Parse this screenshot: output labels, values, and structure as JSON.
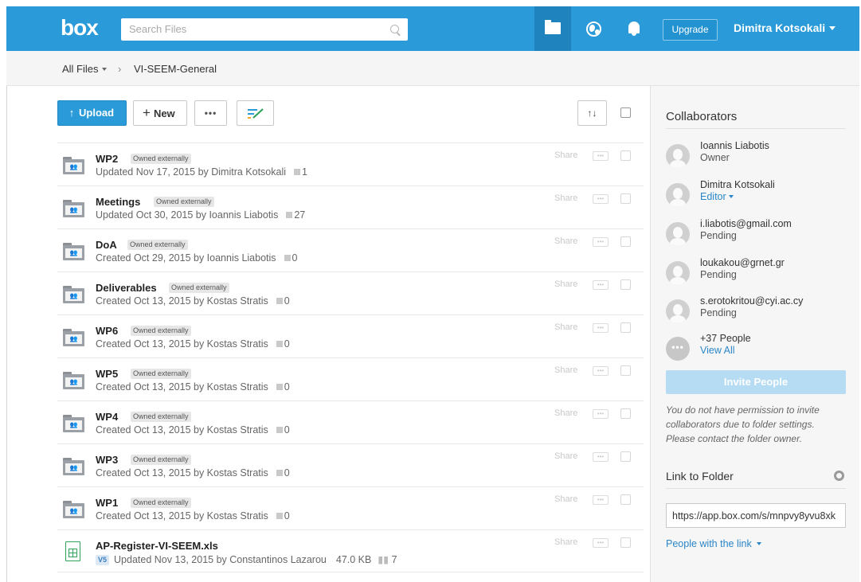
{
  "header": {
    "logo": "box",
    "search_placeholder": "Search Files",
    "upgrade_label": "Upgrade",
    "user_name": "Dimitra Kotsokali",
    "accent_color": "#2a9ad8"
  },
  "breadcrumb": {
    "root": "All Files",
    "separator": "›",
    "current": "VI-SEEM-General"
  },
  "toolbar": {
    "upload_label": "Upload",
    "upload_icon": "↑",
    "new_label": "New",
    "new_icon": "+",
    "more_label": "•••",
    "sort_icon": "↑↓"
  },
  "files": [
    {
      "name": "WP2",
      "badge": "Owned externally",
      "meta": "Updated Nov 17, 2015 by Dimitra Kotsokali",
      "count": "1",
      "share": "Share",
      "icon": "shared-folder-icon"
    },
    {
      "name": "Meetings",
      "badge": "Owned externally",
      "meta": "Updated Oct 30, 2015 by Ioannis Liabotis",
      "count": "27",
      "share": "Share",
      "icon": "shared-folder-icon"
    },
    {
      "name": "DoA",
      "badge": "Owned externally",
      "meta": "Created Oct 29, 2015 by Ioannis Liabotis",
      "count": "0",
      "share": "Share",
      "icon": "shared-folder-icon"
    },
    {
      "name": "Deliverables",
      "badge": "Owned externally",
      "meta": "Created Oct 13, 2015 by Kostas Stratis",
      "count": "0",
      "share": "Share",
      "icon": "shared-folder-icon"
    },
    {
      "name": "WP6",
      "badge": "Owned externally",
      "meta": "Created Oct 13, 2015 by Kostas Stratis",
      "count": "0",
      "share": "Share",
      "icon": "shared-folder-icon"
    },
    {
      "name": "WP5",
      "badge": "Owned externally",
      "meta": "Created Oct 13, 2015 by Kostas Stratis",
      "count": "0",
      "share": "Share",
      "icon": "shared-folder-icon"
    },
    {
      "name": "WP4",
      "badge": "Owned externally",
      "meta": "Created Oct 13, 2015 by Kostas Stratis",
      "count": "0",
      "share": "Share",
      "icon": "shared-folder-icon"
    },
    {
      "name": "WP3",
      "badge": "Owned externally",
      "meta": "Created Oct 13, 2015 by Kostas Stratis",
      "count": "0",
      "share": "Share",
      "icon": "shared-folder-icon"
    },
    {
      "name": "WP1",
      "badge": "Owned externally",
      "meta": "Created Oct 13, 2015 by Kostas Stratis",
      "count": "0",
      "share": "Share",
      "icon": "shared-folder-icon"
    }
  ],
  "spreadsheet": {
    "name": "AP-Register-VI-SEEM.xls",
    "version": "V5",
    "meta": "Updated Nov 13, 2015 by Constantinos Lazarou",
    "size": "47.0 KB",
    "views": "7",
    "share": "Share",
    "icon": "excel-file-icon"
  },
  "sidebar": {
    "collaborators_title": "Collaborators",
    "collaborators": [
      {
        "name": "Ioannis Liabotis",
        "role": "Owner"
      },
      {
        "name": "Dimitra Kotsokali",
        "role": "Editor"
      },
      {
        "name": "i.liabotis@gmail.com",
        "role": "Pending"
      },
      {
        "name": "loukakou@grnet.gr",
        "role": "Pending"
      },
      {
        "name": "s.erotokritou@cyi.ac.cy",
        "role": "Pending"
      }
    ],
    "more_people": "+37 People",
    "view_all": "View All",
    "invite_label": "Invite People",
    "permission_note": "You do not have permission to invite collaborators due to folder settings. Please contact the folder owner.",
    "link_title": "Link to Folder",
    "link_url": "https://app.box.com/s/mnpvy8yvu8xk",
    "link_access": "People with the link"
  }
}
